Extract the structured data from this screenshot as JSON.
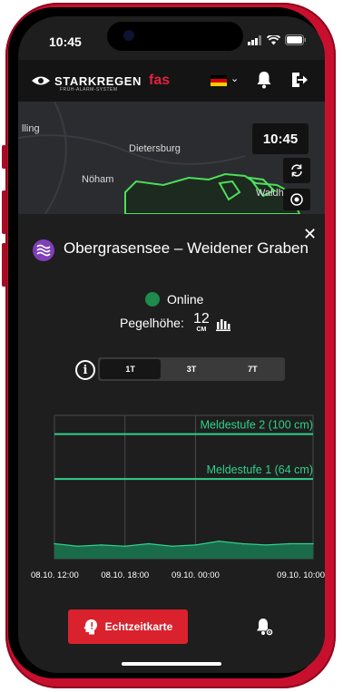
{
  "status_bar": {
    "time": "10:45"
  },
  "app_bar": {
    "logo_text": "STARKREGEN",
    "logo_accent": "fas",
    "logo_sub": "FRÜH-ALARM-SYSTEM",
    "language_flag": "de-flag-icon",
    "icons": [
      "eye-logo-icon",
      "bell-icon",
      "logout-icon"
    ]
  },
  "map": {
    "labels": [
      "lling",
      "Dietersburg",
      "Nöham",
      "Waldhof"
    ],
    "clock": "10:45",
    "controls": [
      "refresh-icon",
      "layers-icon"
    ]
  },
  "station": {
    "title": "Obergrasensee – Weidener Graben",
    "status": "Online",
    "level_label": "Pegelhöhe:",
    "level_value": "12",
    "level_unit": "CM"
  },
  "range_tabs": [
    "1T",
    "3T",
    "7T"
  ],
  "active_range": "1T",
  "chart_data": {
    "type": "area",
    "x_ticks": [
      "08.10. 12:00",
      "08.10. 18:00",
      "09.10. 00:00",
      "09.10. 10:00"
    ],
    "x": [
      "08.10. 12:00",
      "08.10. 14:00",
      "08.10. 16:00",
      "08.10. 18:00",
      "08.10. 20:00",
      "08.10. 22:00",
      "09.10. 00:00",
      "09.10. 02:00",
      "09.10. 04:00",
      "09.10. 06:00",
      "09.10. 08:00",
      "09.10. 10:00"
    ],
    "series": [
      {
        "values": [
          12,
          10,
          11,
          10,
          12,
          10,
          11,
          14,
          12,
          11,
          12,
          12
        ]
      }
    ],
    "thresholds": [
      {
        "label": "Meldestufe 2 (100 cm)",
        "value": 100
      },
      {
        "label": "Meldestufe 1 (64 cm)",
        "value": 64
      }
    ],
    "ylim": [
      0,
      115
    ],
    "grid": true,
    "colors": {
      "fill": "#1a6b4a",
      "line": "#2fd08a",
      "threshold": "#2fd08a"
    }
  },
  "bottom_nav": {
    "realtime_label": "Echtzeitkarte",
    "alarm_icon": "alarm-settings-icon"
  }
}
